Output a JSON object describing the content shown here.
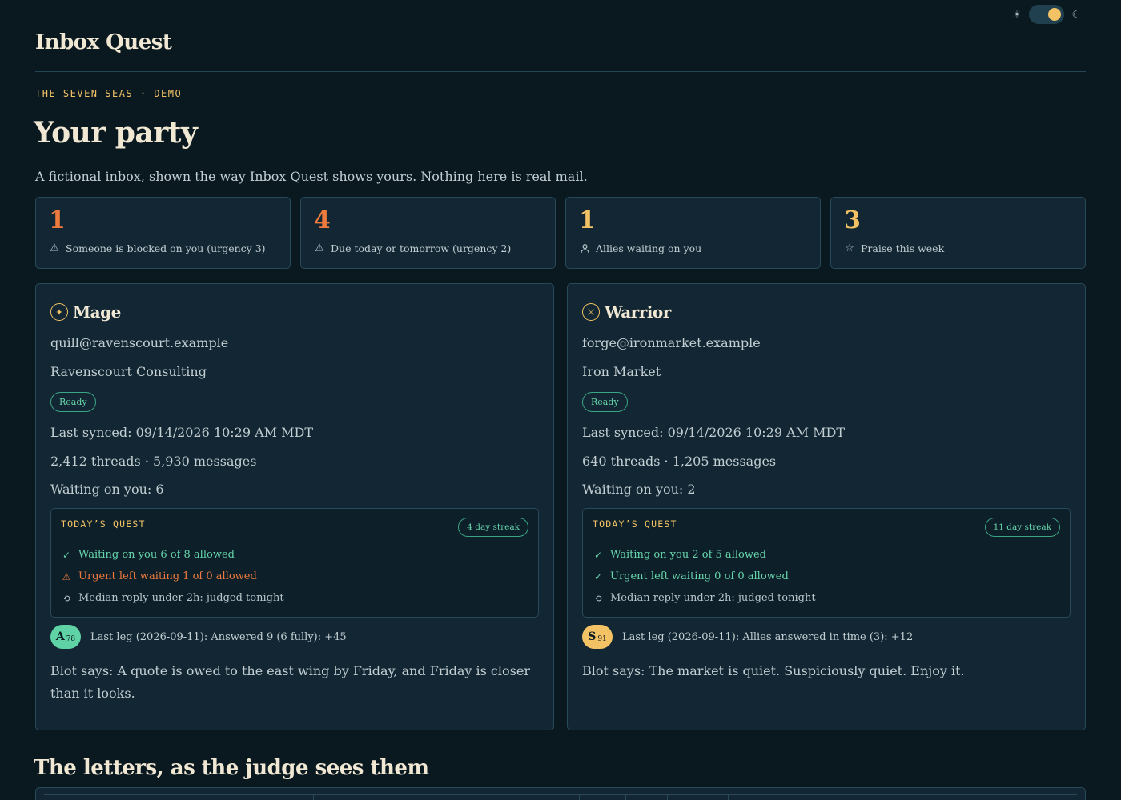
{
  "theme_toggle": {
    "sun_icon": "sun-icon",
    "moon_icon": "moon-icon",
    "state": "dark"
  },
  "header": {
    "title": "Inbox Quest"
  },
  "eyebrow": "THE SEVEN SEAS · DEMO",
  "page_title": "Your party",
  "intro": "A fictional inbox, shown the way Inbox Quest shows yours. Nothing here is real mail.",
  "stats": [
    {
      "value": "1",
      "label": "Someone is blocked on you (urgency 3)",
      "icon": "warning-icon",
      "color": "#ee7a3d"
    },
    {
      "value": "4",
      "label": "Due today or tomorrow (urgency 2)",
      "icon": "warning-icon",
      "color": "#ee7a3d"
    },
    {
      "value": "1",
      "label": "Allies waiting on you",
      "icon": "person-icon",
      "color": "#f2c265"
    },
    {
      "value": "3",
      "label": "Praise this week",
      "icon": "star-icon",
      "color": "#f2c265"
    }
  ],
  "party": [
    {
      "class_name": "Mage",
      "class_icon": "sparkle-icon",
      "email": "quill@ravenscourt.example",
      "org": "Ravenscourt Consulting",
      "status": "Ready",
      "synced": "Last synced: 09/14/2026 10:29 AM MDT",
      "counts": "2,412 threads · 5,930 messages",
      "waiting": "Waiting on you: 6",
      "quest": {
        "title": "TODAY’S QUEST",
        "streak": "4 day streak",
        "items": [
          {
            "state": "ok",
            "text": "Waiting on you 6 of 8 allowed"
          },
          {
            "state": "warn",
            "text": "Urgent left waiting 1 of 0 allowed"
          },
          {
            "state": "pending",
            "text": "Median reply under 2h: judged tonight"
          }
        ]
      },
      "level": {
        "glyph": "A",
        "number": "78",
        "color": "teal"
      },
      "last_leg": "Last leg (2026-09-11): Answered 9 (6 fully): +45",
      "blot": "Blot says: A quote is owed to the east wing by Friday, and Friday is closer than it looks."
    },
    {
      "class_name": "Warrior",
      "class_icon": "crossed-swords-icon",
      "email": "forge@ironmarket.example",
      "org": "Iron Market",
      "status": "Ready",
      "synced": "Last synced: 09/14/2026 10:29 AM MDT",
      "counts": "640 threads · 1,205 messages",
      "waiting": "Waiting on you: 2",
      "quest": {
        "title": "TODAY’S QUEST",
        "streak": "11 day streak",
        "items": [
          {
            "state": "ok",
            "text": "Waiting on you 2 of 5 allowed"
          },
          {
            "state": "ok",
            "text": "Urgent left waiting 0 of 0 allowed"
          },
          {
            "state": "pending",
            "text": "Median reply under 2h: judged tonight"
          }
        ]
      },
      "level": {
        "glyph": "S",
        "number": "91",
        "color": "gold"
      },
      "last_leg": "Last leg (2026-09-11): Allies answered in time (3): +12",
      "blot": "Blot says: The market is quiet. Suspiciously quiet. Enjoy it."
    }
  ],
  "letters_section": {
    "title": "The letters, as the judge sees them"
  }
}
